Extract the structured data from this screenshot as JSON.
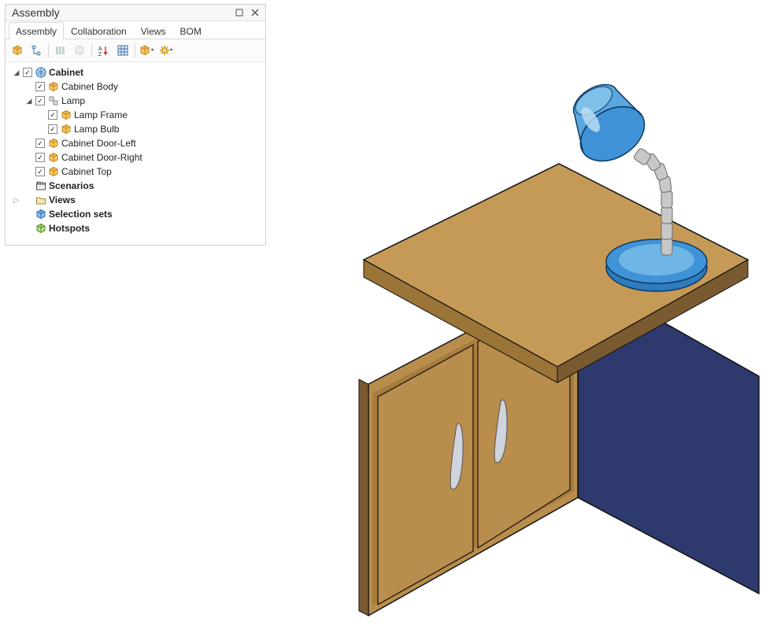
{
  "panel": {
    "title": "Assembly"
  },
  "tabs": {
    "assembly": "Assembly",
    "collaboration": "Collaboration",
    "views": "Views",
    "bom": "BOM"
  },
  "tree": {
    "root": "Cabinet",
    "cabinet_body": "Cabinet Body",
    "lamp": "Lamp",
    "lamp_frame": "Lamp Frame",
    "lamp_bulb": "Lamp Bulb",
    "door_left": "Cabinet Door-Left",
    "door_right": "Cabinet Door-Right",
    "cabinet_top": "Cabinet Top",
    "scenarios": "Scenarios",
    "views": "Views",
    "selection_sets": "Selection sets",
    "hotspots": "Hotspots"
  }
}
